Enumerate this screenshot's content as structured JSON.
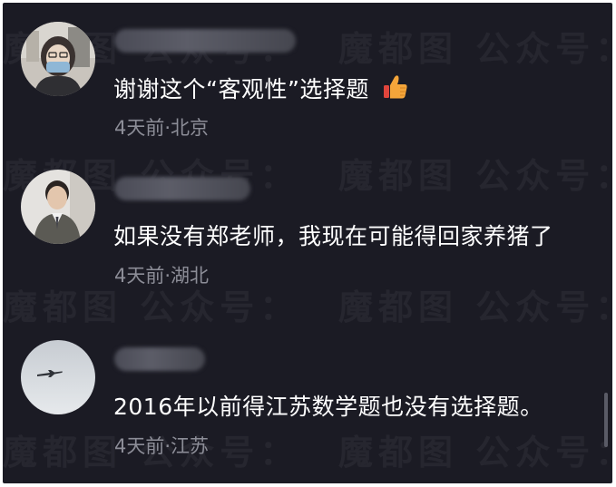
{
  "watermark": "魔都图  公众号：",
  "comments": [
    {
      "text": "谢谢这个“客观性”选择题",
      "emoji": "thumbs-up-icon",
      "meta": "4天前·北京"
    },
    {
      "text": "如果没有郑老师，我现在可能得回家养猪了",
      "meta": "4天前·湖北"
    },
    {
      "text": "2016年以前得江苏数学题也没有选择题。",
      "meta": "4天前·江苏"
    }
  ],
  "colors": {
    "background": "#1b1b24",
    "text": "#ffffff",
    "meta": "#8c8d97",
    "emoji": "#f4a53a"
  }
}
